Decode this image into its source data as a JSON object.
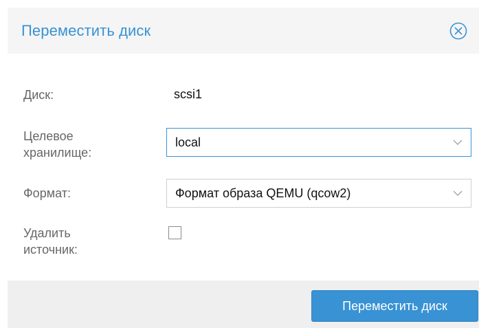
{
  "dialog": {
    "title": "Переместить диск",
    "close_icon": "close-circle-icon",
    "accent_color": "#3892d4"
  },
  "form": {
    "disk": {
      "label": "Диск:",
      "value": "scsi1"
    },
    "target_storage": {
      "label_line1": "Целевое",
      "label_line2": "хранилище:",
      "value": "local"
    },
    "format": {
      "label": "Формат:",
      "value": "Формат образа QEMU (qcow2)"
    },
    "delete_source": {
      "label_line1": "Удалить",
      "label_line2": "источник:",
      "checked": false
    }
  },
  "footer": {
    "move_button_label": "Переместить диск"
  }
}
